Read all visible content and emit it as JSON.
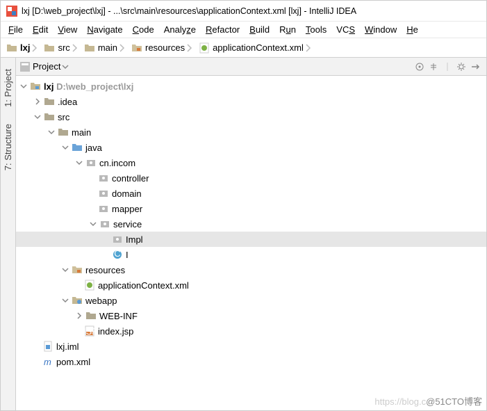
{
  "title": "lxj [D:\\web_project\\lxj] - ...\\src\\main\\resources\\applicationContext.xml [lxj] - IntelliJ IDEA",
  "menu": {
    "file": "File",
    "edit": "Edit",
    "view": "View",
    "navigate": "Navigate",
    "code": "Code",
    "analyze": "Analyze",
    "refactor": "Refactor",
    "build": "Build",
    "run": "Run",
    "tools": "Tools",
    "vcs": "VCS",
    "window": "Window",
    "help": "He"
  },
  "breadcrumbs": [
    "lxj",
    "src",
    "main",
    "resources",
    "applicationContext.xml"
  ],
  "panel": {
    "title": "Project"
  },
  "side_tabs": {
    "project": "1: Project",
    "structure": "7: Structure"
  },
  "tree": {
    "root": {
      "name": "lxj",
      "path": "D:\\web_project\\lxj"
    },
    "idea": ".idea",
    "src": "src",
    "main": "main",
    "java": "java",
    "pkg": "cn.incom",
    "controller": "controller",
    "domain": "domain",
    "mapper": "mapper",
    "service": "service",
    "impl": "Impl",
    "iClass": "I",
    "resources": "resources",
    "appCtx": "applicationContext.xml",
    "webapp": "webapp",
    "webinf": "WEB-INF",
    "indexjsp": "index.jsp",
    "iml": "lxj.iml",
    "pom": "pom.xml"
  },
  "watermark": {
    "light": "https://blog.c",
    "dark": "@51CTO博客"
  }
}
